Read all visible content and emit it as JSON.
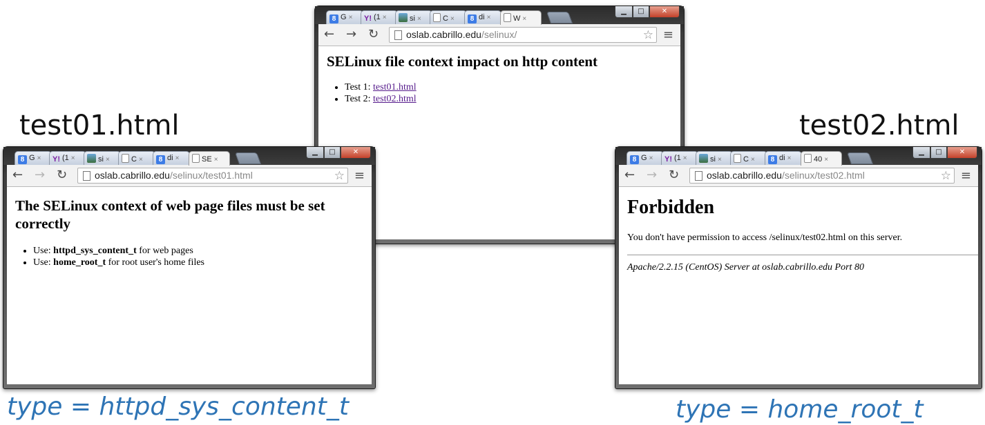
{
  "captions": {
    "left_file": "test01.html",
    "right_file": "test02.html",
    "left_type": "type = httpd_sys_content_t",
    "right_type": "type = home_root_t"
  },
  "icons": {
    "back": "back-arrow-icon",
    "forward": "forward-arrow-icon",
    "reload": "reload-icon",
    "page": "page-icon",
    "bookmark": "bookmark-star-icon",
    "menu": "menu-icon",
    "tab_close": "tab-close-icon"
  },
  "common_tabs": {
    "t1": "G",
    "t2": "(1",
    "t3": "si",
    "t4": "C",
    "t5": "di",
    "yahoo_logo": "Y!",
    "close_glyph": "×"
  },
  "window_main": {
    "tab5_label": "di",
    "active_tab_label": "W",
    "url_host": "oslab.cabrillo.edu",
    "url_path": "/selinux/",
    "heading": "SELinux file context impact on http content",
    "items": [
      {
        "prefix": "Test 1: ",
        "link": "test01.html"
      },
      {
        "prefix": "Test 2: ",
        "link": "test02.html"
      }
    ]
  },
  "window_left": {
    "tab5_label": "di",
    "active_tab_label": "SE",
    "url_host": "oslab.cabrillo.edu",
    "url_path": "/selinux/test01.html",
    "heading": "The SELinux context of web page files must be set correctly",
    "items": [
      {
        "prefix": "Use: ",
        "bold": "httpd_sys_content_t",
        "suffix": " for web pages"
      },
      {
        "prefix": "Use: ",
        "bold": "home_root_t",
        "suffix": " for root user's home files"
      }
    ]
  },
  "window_right": {
    "tab5_label": "di",
    "active_tab_label": "40",
    "url_host": "oslab.cabrillo.edu",
    "url_path": "/selinux/test02.html",
    "heading": "Forbidden",
    "message": "You don't have permission to access /selinux/test02.html on this server.",
    "server_line": "Apache/2.2.15 (CentOS) Server at oslab.cabrillo.edu Port 80"
  }
}
